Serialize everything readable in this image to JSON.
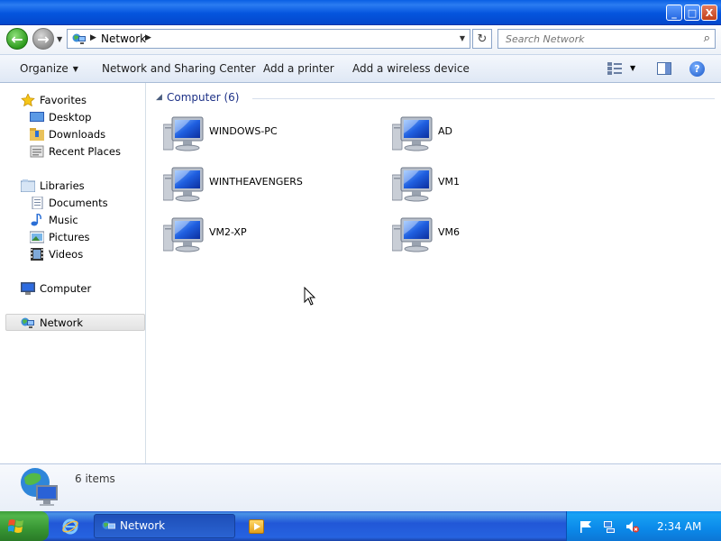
{
  "window": {
    "buttons": {
      "minimize": "_",
      "maximize": "□",
      "close": "X"
    }
  },
  "address": {
    "crumbs": [
      "Network"
    ],
    "search_placeholder": "Search Network"
  },
  "toolbar": {
    "organize": "Organize",
    "network_sharing": "Network and Sharing Center",
    "add_printer": "Add a printer",
    "add_wireless": "Add a wireless device"
  },
  "nav": {
    "favorites": "Favorites",
    "desktop": "Desktop",
    "downloads": "Downloads",
    "recent": "Recent Places",
    "libraries": "Libraries",
    "documents": "Documents",
    "music": "Music",
    "pictures": "Pictures",
    "videos": "Videos",
    "computer": "Computer",
    "network": "Network"
  },
  "content": {
    "group_title": "Computer (6)",
    "computers": [
      "WINDOWS-PC",
      "AD",
      "WINTHEAVENGERS",
      "VM1",
      "VM2-XP",
      "VM6"
    ]
  },
  "details": {
    "count": "6 items"
  },
  "taskbar": {
    "task_label": "Network",
    "clock": "2:34 AM"
  },
  "colors": {
    "titlebar": "#0455de",
    "group_title": "#1e3287",
    "taskbar": "#2157d7",
    "start": "#379533",
    "tray": "#0b89e9"
  },
  "icons": [
    "back-icon",
    "forward-icon",
    "network-icon",
    "refresh-icon",
    "search-icon",
    "views-icon",
    "preview-pane-icon",
    "help-icon",
    "star-icon",
    "desktop-icon",
    "downloads-icon",
    "recent-places-icon",
    "libraries-icon",
    "documents-icon",
    "music-icon",
    "pictures-icon",
    "videos-icon",
    "computer-icon",
    "globe-icon",
    "windows-flag-icon",
    "ie-icon",
    "media-player-icon",
    "flag-icon",
    "network-tray-icon",
    "volume-muted-icon"
  ]
}
